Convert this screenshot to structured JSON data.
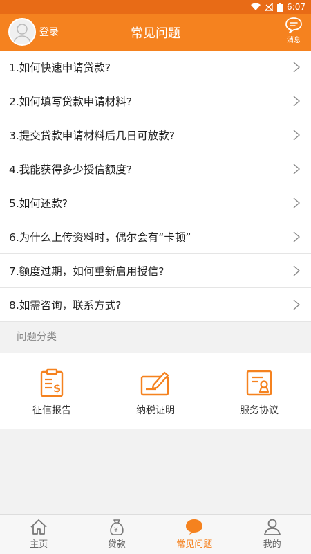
{
  "status_bar": {
    "time": "6:07"
  },
  "header": {
    "login": "登录",
    "title": "常见问题",
    "message": "消息"
  },
  "faq": [
    {
      "label": "1.如何快速申请贷款?"
    },
    {
      "label": "2.如何填写贷款申请材料?"
    },
    {
      "label": "3.提交贷款申请材料后几日可放款?"
    },
    {
      "label": "4.我能获得多少授信额度?"
    },
    {
      "label": "5.如何还款?"
    },
    {
      "label": "6.为什么上传资料时，偶尔会有“卡顿”"
    },
    {
      "label": "7.额度过期，如何重新启用授信?"
    },
    {
      "label": "8.如需咨询，联系方式?"
    }
  ],
  "categories": {
    "title": "问题分类",
    "items": [
      {
        "label": "征信报告",
        "icon": "credit-report-icon"
      },
      {
        "label": "纳税证明",
        "icon": "tax-certificate-icon"
      },
      {
        "label": "服务协议",
        "icon": "service-agreement-icon"
      }
    ]
  },
  "tabs": [
    {
      "label": "主页",
      "icon": "home-icon"
    },
    {
      "label": "贷款",
      "icon": "money-bag-icon"
    },
    {
      "label": "常见问题",
      "icon": "chat-bubble-icon",
      "active": true
    },
    {
      "label": "我的",
      "icon": "person-icon"
    }
  ],
  "colors": {
    "accent": "#f5821f",
    "status_bar": "#e86b16"
  }
}
